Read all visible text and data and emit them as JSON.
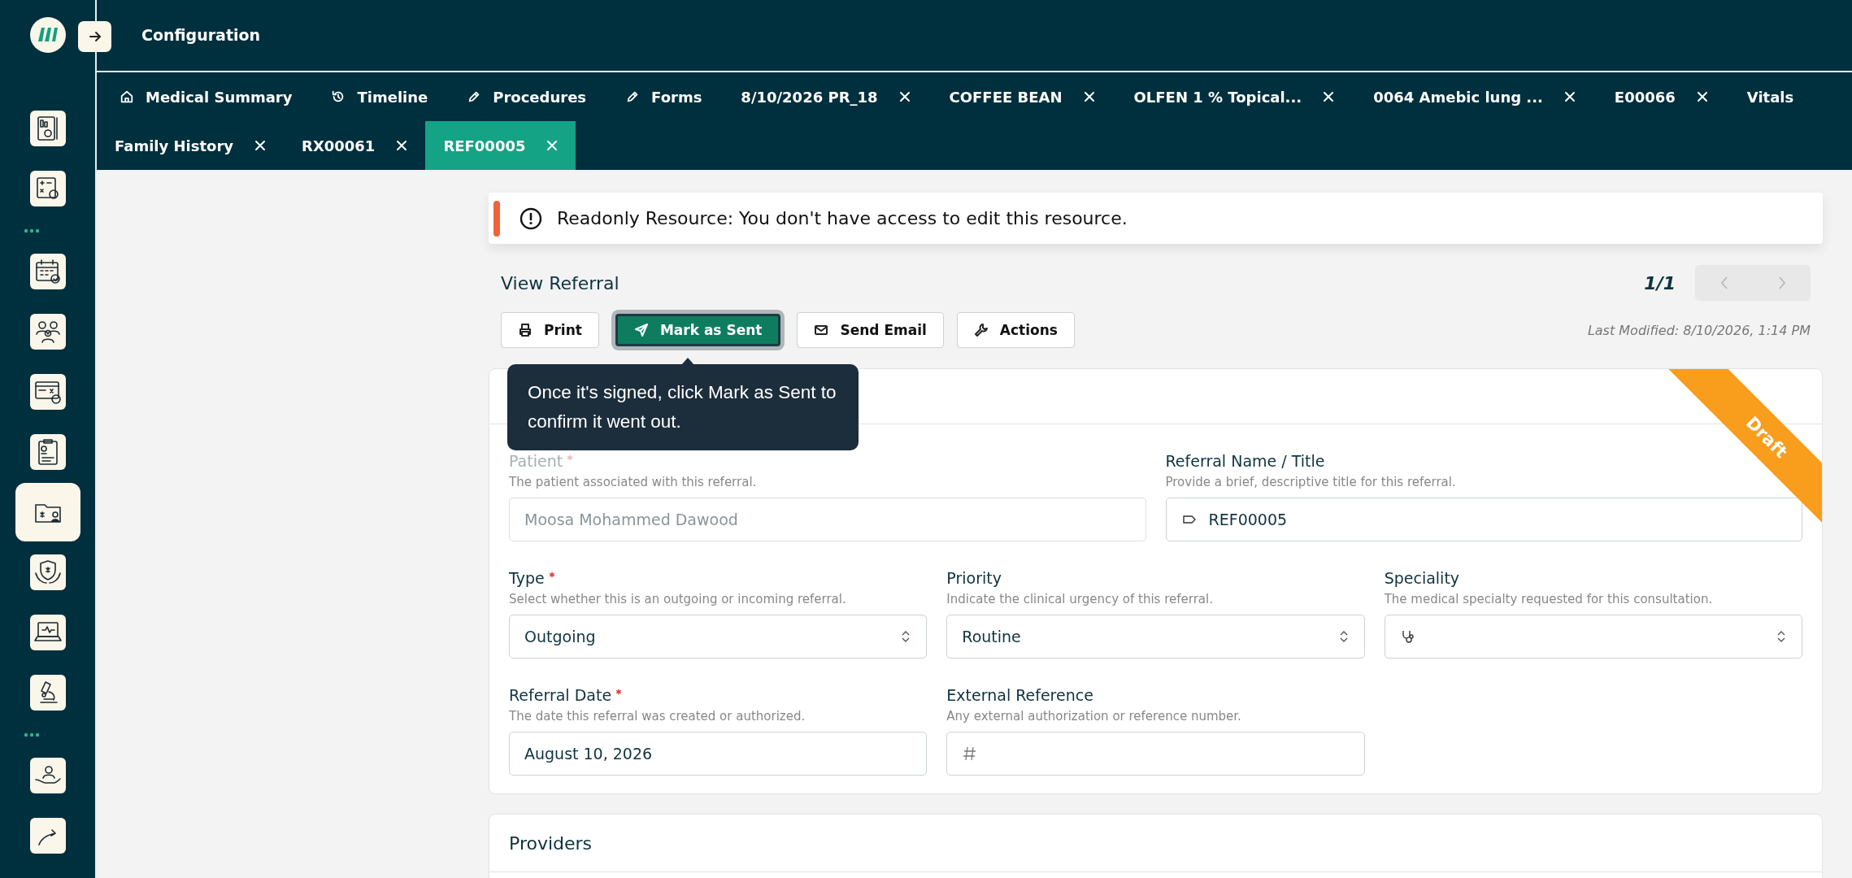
{
  "sidebar": {
    "items": [
      {
        "kind": "icon",
        "selected": false
      },
      {
        "kind": "icon",
        "selected": false
      },
      {
        "kind": "separator"
      },
      {
        "kind": "icon",
        "selected": false
      },
      {
        "kind": "icon",
        "selected": false
      },
      {
        "kind": "icon",
        "selected": false
      },
      {
        "kind": "icon",
        "selected": false
      },
      {
        "kind": "icon",
        "selected": true
      },
      {
        "kind": "icon",
        "selected": false
      },
      {
        "kind": "icon",
        "selected": false
      },
      {
        "kind": "icon",
        "selected": false
      },
      {
        "kind": "separator"
      },
      {
        "kind": "icon",
        "selected": false
      },
      {
        "kind": "icon",
        "selected": false
      }
    ]
  },
  "header": {
    "title": "Configuration"
  },
  "tabs_row_1": [
    {
      "label": "Medical Summary",
      "closable": false,
      "selected": false
    },
    {
      "label": "Timeline",
      "closable": false,
      "selected": false
    },
    {
      "label": "Procedures",
      "closable": false,
      "selected": false
    },
    {
      "label": "Forms",
      "closable": false,
      "selected": false
    },
    {
      "label": "8/10/2026 PR_18",
      "closable": true,
      "selected": false
    },
    {
      "label": "COFFEE BEAN",
      "closable": true,
      "selected": false
    },
    {
      "label": "OLFEN 1 % Topical...",
      "closable": true,
      "selected": false
    },
    {
      "label": "0064 Amebic lung ...",
      "closable": true,
      "selected": false
    },
    {
      "label": "E00066",
      "closable": true,
      "selected": false
    },
    {
      "label": "Vitals",
      "closable": false,
      "selected": false
    }
  ],
  "tabs_row_2": [
    {
      "label": "Family History",
      "closable": true,
      "selected": false
    },
    {
      "label": "RX00061",
      "closable": true,
      "selected": false
    },
    {
      "label": "REF00005",
      "closable": true,
      "selected": true
    }
  ],
  "alert": {
    "message": "Readonly Resource: You don't have access to edit this resource."
  },
  "page": {
    "title": "View Referral",
    "pager": "1/1",
    "last_modified": "Last Modified: 8/10/2026, 1:14 PM"
  },
  "actions": [
    {
      "label": "Print",
      "kind": "default",
      "focused": false
    },
    {
      "label": "Mark as Sent",
      "kind": "primary",
      "focused": true
    },
    {
      "label": "Send Email",
      "kind": "default",
      "focused": false
    },
    {
      "label": "Actions",
      "kind": "default",
      "focused": false
    }
  ],
  "tooltip": {
    "text": "Once it's signed, click Mark as Sent to confirm it went out."
  },
  "card": {
    "ribbon": "Draft",
    "rows": [
      [
        {
          "label": "Patient",
          "required": true,
          "disabled": true,
          "hint": "The patient associated with this referral.",
          "kind": "text",
          "value": "Moosa Mohammed Dawood"
        },
        {
          "label": "Referral Name / Title",
          "required": false,
          "disabled": false,
          "hint": "Provide a brief, descriptive title for this referral.",
          "kind": "text",
          "value": "REF00005"
        }
      ],
      [
        {
          "label": "Type",
          "required": true,
          "disabled": false,
          "hint": "Select whether this is an outgoing or incoming referral.",
          "kind": "select",
          "value": "Outgoing"
        },
        {
          "label": "Priority",
          "required": false,
          "disabled": false,
          "hint": "Indicate the clinical urgency of this referral.",
          "kind": "select",
          "value": "Routine"
        },
        {
          "label": "Speciality",
          "required": false,
          "disabled": false,
          "hint": "The medical specialty requested for this consultation.",
          "kind": "select"
        }
      ],
      [
        {
          "label": "Referral Date",
          "required": true,
          "disabled": false,
          "hint": "The date this referral was created or authorized.",
          "kind": "text",
          "value": "August 10, 2026"
        },
        {
          "label": "External Reference",
          "required": false,
          "disabled": false,
          "hint": "Any external authorization or reference number.",
          "kind": "text"
        }
      ]
    ]
  },
  "providers": {
    "title": "Providers"
  }
}
